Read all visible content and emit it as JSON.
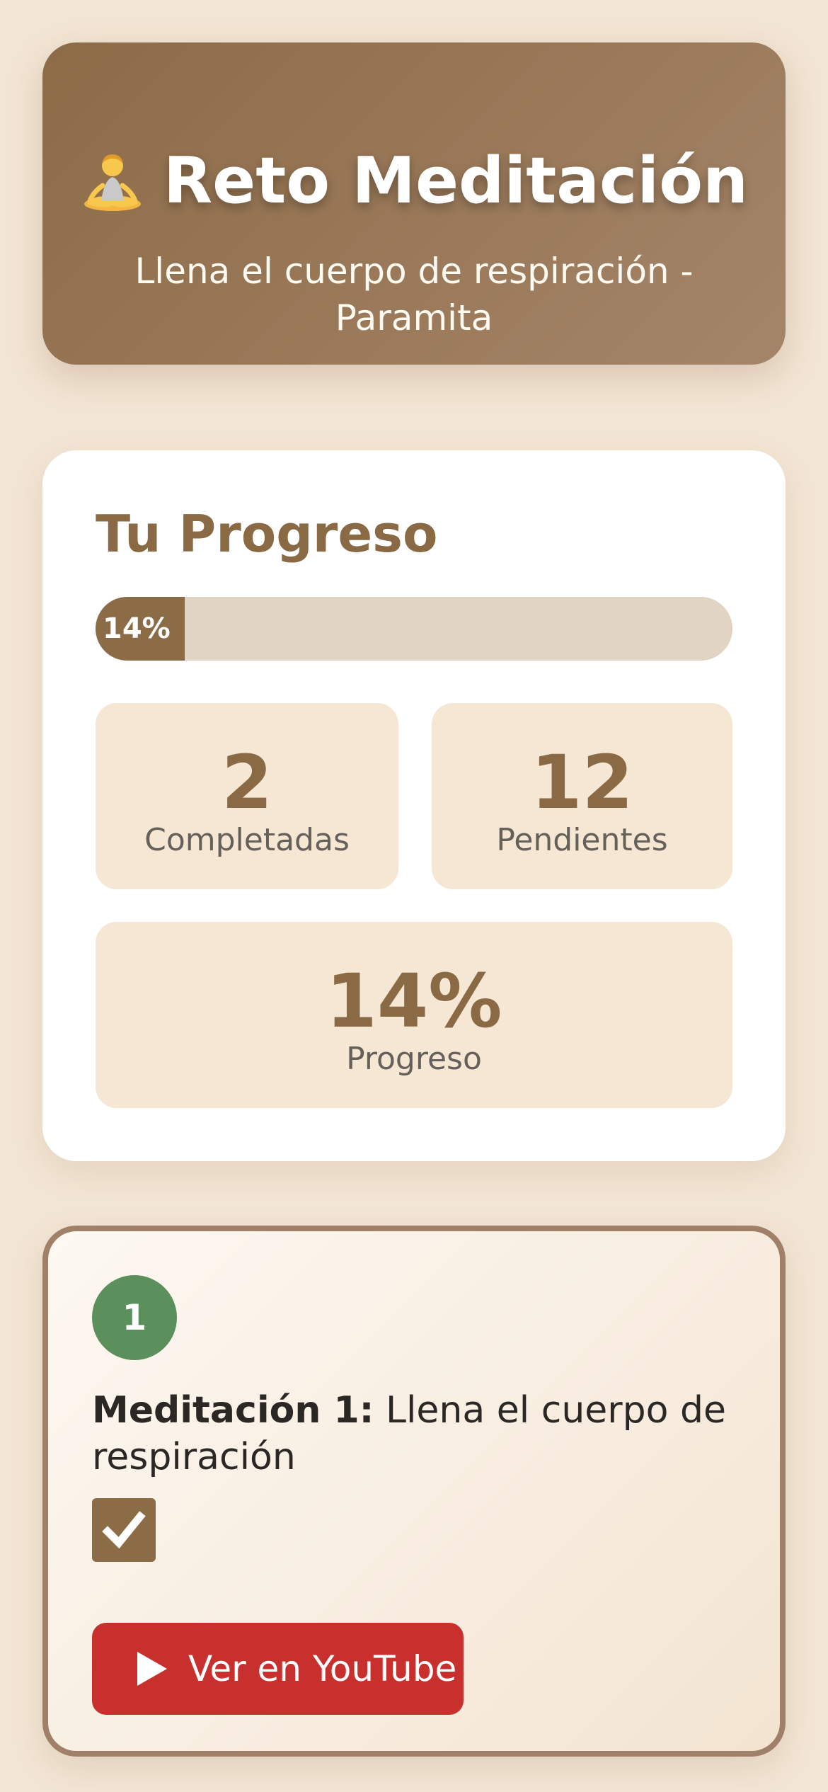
{
  "header": {
    "title": "Reto Meditación",
    "subtitle": "Llena el cuerpo de respiración - Paramita",
    "icon": "meditation-icon"
  },
  "progress": {
    "title": "Tu Progreso",
    "bar_label": "14%",
    "bar_value": 0.14,
    "completed": {
      "value": "2",
      "label": "Completadas"
    },
    "pending": {
      "value": "12",
      "label": "Pendientes"
    },
    "overall": {
      "value": "14%",
      "label": "Progreso"
    }
  },
  "lessons": [
    {
      "number": "1",
      "title_prefix": "Meditación 1:",
      "title_text": " Llena el cuerpo de respiración",
      "completed": true,
      "button_label": "Ver en YouTube",
      "button_icon": "play-icon"
    }
  ],
  "colors": {
    "background": "#f3e5d4",
    "accent": "#8c6b47",
    "number_badge": "#5b8f5c",
    "youtube": "#c8302e"
  }
}
